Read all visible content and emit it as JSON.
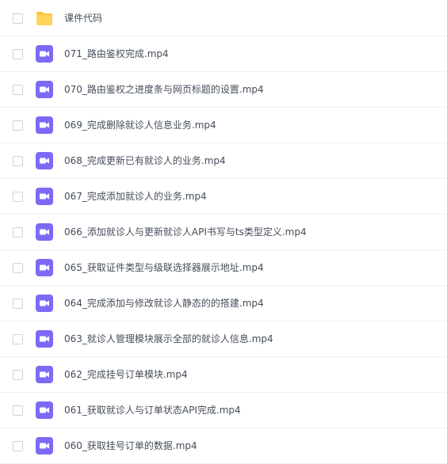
{
  "colors": {
    "folder": "#ffd45c",
    "folder_tab": "#f7c43d",
    "video": "#7c6af7",
    "text": "#454d5a",
    "divider": "#f0f0f2",
    "checkbox_border": "#cfd2d8"
  },
  "file_list": {
    "items": [
      {
        "name": "课件代码",
        "type": "folder",
        "icon": "folder-icon"
      },
      {
        "name": "071_路由鉴权完成.mp4",
        "type": "video",
        "icon": "video-file-icon"
      },
      {
        "name": "070_路由鉴权之进度条与网页标题的设置.mp4",
        "type": "video",
        "icon": "video-file-icon"
      },
      {
        "name": "069_完成删除就诊人信息业务.mp4",
        "type": "video",
        "icon": "video-file-icon"
      },
      {
        "name": "068_完成更新已有就诊人的业务.mp4",
        "type": "video",
        "icon": "video-file-icon"
      },
      {
        "name": "067_完成添加就诊人的业务.mp4",
        "type": "video",
        "icon": "video-file-icon"
      },
      {
        "name": "066_添加就诊人与更新就诊人API书写与ts类型定义.mp4",
        "type": "video",
        "icon": "video-file-icon"
      },
      {
        "name": "065_获取证件类型与级联选择器展示地址.mp4",
        "type": "video",
        "icon": "video-file-icon"
      },
      {
        "name": "064_完成添加与修改就诊人静态的的搭建.mp4",
        "type": "video",
        "icon": "video-file-icon"
      },
      {
        "name": "063_就诊人管理模块展示全部的就诊人信息.mp4",
        "type": "video",
        "icon": "video-file-icon"
      },
      {
        "name": "062_完成挂号订单模块.mp4",
        "type": "video",
        "icon": "video-file-icon"
      },
      {
        "name": "061_获取就诊人与订单状态API完成.mp4",
        "type": "video",
        "icon": "video-file-icon"
      },
      {
        "name": "060_获取挂号订单的数据.mp4",
        "type": "video",
        "icon": "video-file-icon"
      }
    ]
  }
}
